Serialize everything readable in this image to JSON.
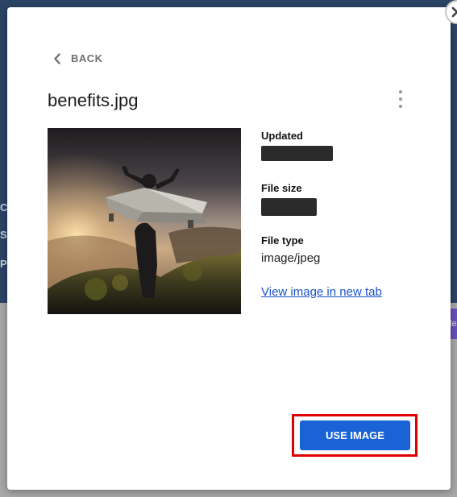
{
  "background": {
    "fragments": [
      "Co",
      "Sl",
      "Pr"
    ],
    "purple_tab_text": "le"
  },
  "modal": {
    "back_label": "BACK",
    "file_name": "benefits.jpg",
    "details": {
      "updated_label": "Updated",
      "file_size_label": "File size",
      "file_type_label": "File type",
      "file_type_value": "image/jpeg"
    },
    "view_link": "View image in new tab",
    "use_button": "USE IMAGE"
  },
  "icons": {
    "close": "close-icon",
    "back": "chevron-left-icon",
    "more": "more-vertical-icon",
    "preview": "image-preview"
  },
  "colors": {
    "backdrop_dark": "#2b4466",
    "backdrop_gray": "#a8a8a8",
    "primary_button": "#1a63d6",
    "link": "#1a52c9",
    "highlight": "#e00000"
  }
}
